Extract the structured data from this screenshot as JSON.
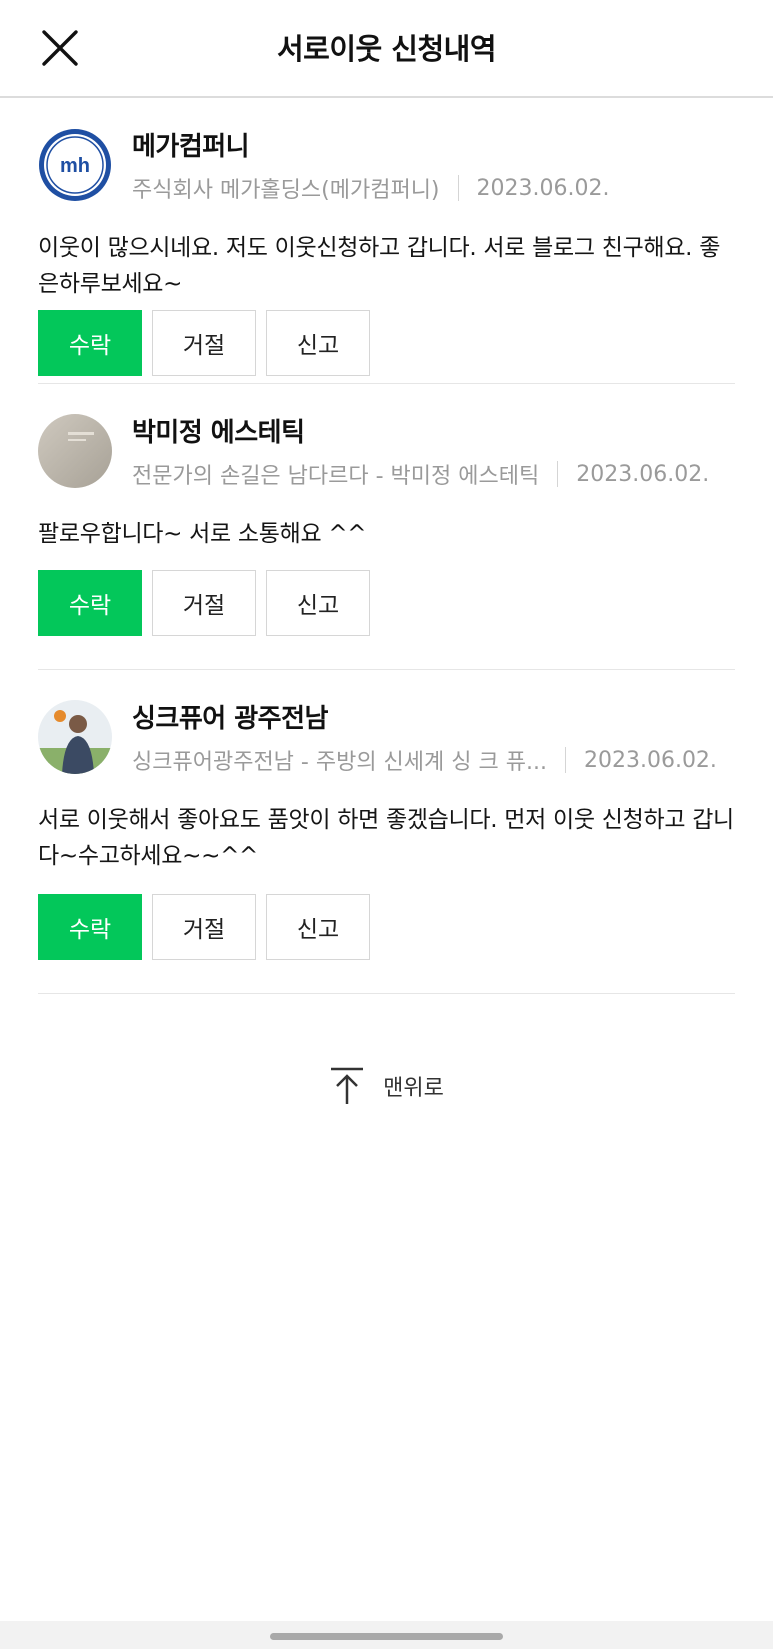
{
  "header": {
    "title": "서로이웃 신청내역",
    "close_icon": "close-icon"
  },
  "requests": [
    {
      "name": "메가컴퍼니",
      "blog": "주식회사 메가홀딩스(메가컴퍼니)",
      "date": "2023.06.02.",
      "message": "이웃이 많으시네요. 저도 이웃신청하고 갑니다. 서로 블로그 친구해요. 좋은하루보세요~",
      "avatar_icon": "company-logo-avatar"
    },
    {
      "name": "박미정 에스테틱",
      "blog": "전문가의 손길은 남다르다 - 박미정 에스테틱",
      "date": "2023.06.02.",
      "message": "팔로우합니다~ 서로 소통해요 ^^",
      "avatar_icon": "photo-avatar"
    },
    {
      "name": "싱크퓨어 광주전남",
      "blog": "싱크퓨어광주전남 - 주방의 신세계 싱 크 퓨...",
      "date": "2023.06.02.",
      "message": "서로 이웃해서 좋아요도 품앗이 하면 좋겠습니다. 먼저 이웃 신청하고 갑니다~수고하세요~~^^",
      "avatar_icon": "person-photo-avatar"
    }
  ],
  "actions": {
    "accept": "수락",
    "reject": "거절",
    "report": "신고"
  },
  "to_top": {
    "label": "맨위로",
    "icon": "arrow-up-icon"
  },
  "colors": {
    "accent": "#03c75a",
    "meta": "#9a9a9a",
    "divider": "#e6e6e6"
  }
}
